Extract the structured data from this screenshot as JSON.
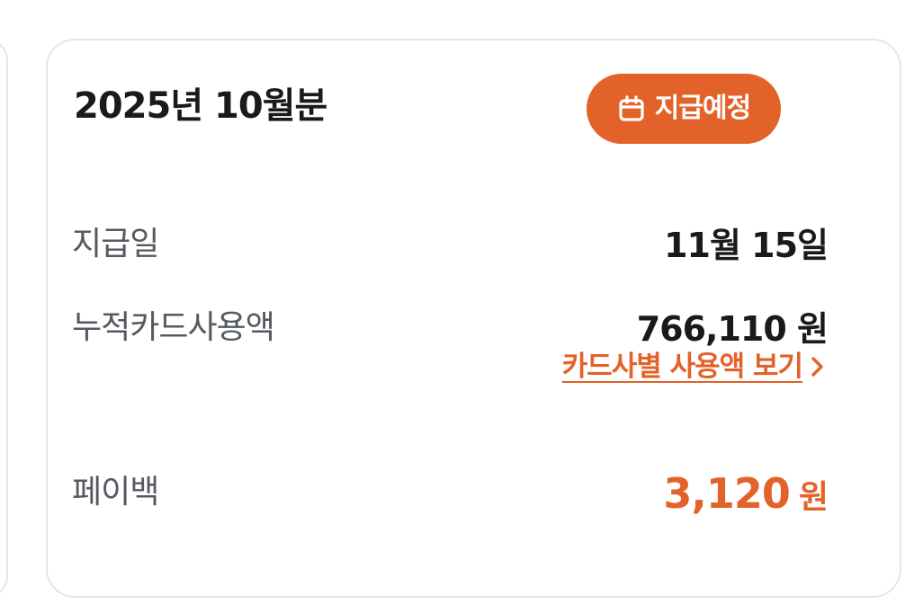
{
  "card": {
    "title": "2025년 10월분",
    "badge": {
      "icon": "calendar-icon",
      "label": "지급예정",
      "color": "#E2622A"
    },
    "rows": [
      {
        "label": "지급일",
        "value": "11월 15일"
      },
      {
        "label": "누적카드사용액",
        "value": "766,110 원"
      }
    ],
    "link": {
      "label": "카드사별 사용액 보기",
      "icon": "chevron-right-icon"
    },
    "payback": {
      "label": "페이백",
      "amount": "3,120",
      "unit": "원"
    }
  },
  "colors": {
    "accent": "#E2622A",
    "text_primary": "#1A1A1A",
    "text_secondary": "#555A60",
    "border": "#E6E6E6"
  }
}
